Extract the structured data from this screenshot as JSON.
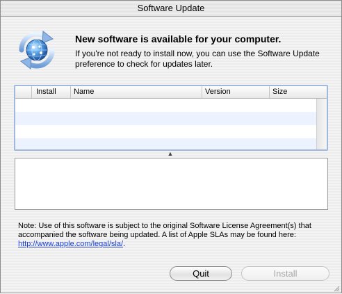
{
  "window": {
    "title": "Software Update"
  },
  "header": {
    "icon": "software-update-globe-icon",
    "headline": "New software is available for your computer.",
    "subtext": "If you're not ready to install now, you can use the Software Update preference to check for updates later."
  },
  "table": {
    "columns": [
      "",
      "Install",
      "Name",
      "Version",
      "Size"
    ],
    "rows": []
  },
  "note": {
    "text": "Note: Use of this software is subject to the original Software License Agreement(s) that accompanied the software being updated. A list of Apple SLAs may be found here: ",
    "link": "http://www.apple.com/legal/sla/",
    "suffix": "."
  },
  "buttons": {
    "quit": "Quit",
    "install": "Install"
  },
  "colors": {
    "table_focus_border": "#9fb8dc",
    "alt_row": "#edf3fe",
    "link": "#1a3ecf"
  }
}
